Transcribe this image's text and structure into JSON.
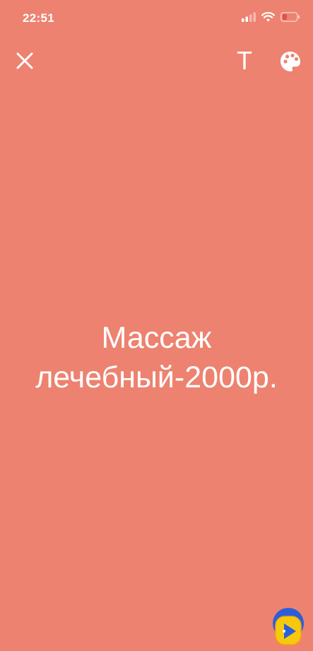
{
  "status_bar": {
    "time": "22:51",
    "icons": [
      "signal-bars-icon",
      "wifi-icon",
      "battery-low-icon"
    ]
  },
  "toolbar": {
    "close_icon": "close-icon",
    "text_tool_label": "T",
    "palette_icon": "palette-icon"
  },
  "story": {
    "background_color": "#ED8270",
    "text_color": "#FFFFFF",
    "lines": [
      "Массаж",
      "лечебный-2000р."
    ]
  },
  "overlay": {
    "widget_icon": "assistant-widget-icon"
  }
}
